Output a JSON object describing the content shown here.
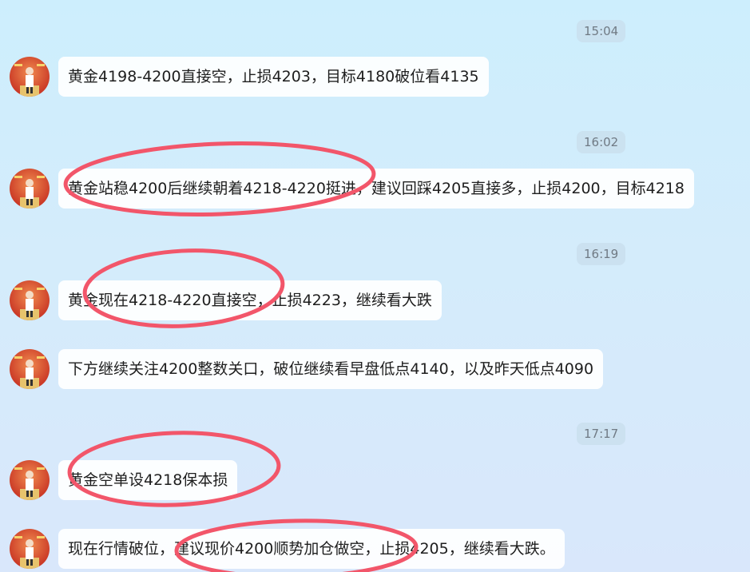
{
  "messages": [
    {
      "time": "15:04",
      "text": "黄金4198-4200直接空，止损4203，目标4180破位看4135"
    },
    {
      "time": "16:02",
      "text": "黄金站稳4200后继续朝着4218-4220挺进，建议回踩4205直接多，止损4200，目标4218"
    },
    {
      "time": "16:19",
      "text": "黄金现在4218-4220直接空，止损4223，继续看大跌"
    },
    {
      "text": "下方继续关注4200整数关口，破位继续看早盘低点4140，以及昨天低点4090"
    },
    {
      "time": "17:17",
      "text": "黄金空单设4218保本损"
    },
    {
      "text": "现在行情破位，建议现价4200顺势加仓做空，止损4205，继续看大跌。"
    }
  ],
  "colors": {
    "highlight_ellipse": "#f2566a",
    "avatar_bg": "#d8432c"
  },
  "icons": {
    "avatar": "sender-avatar-icon"
  }
}
